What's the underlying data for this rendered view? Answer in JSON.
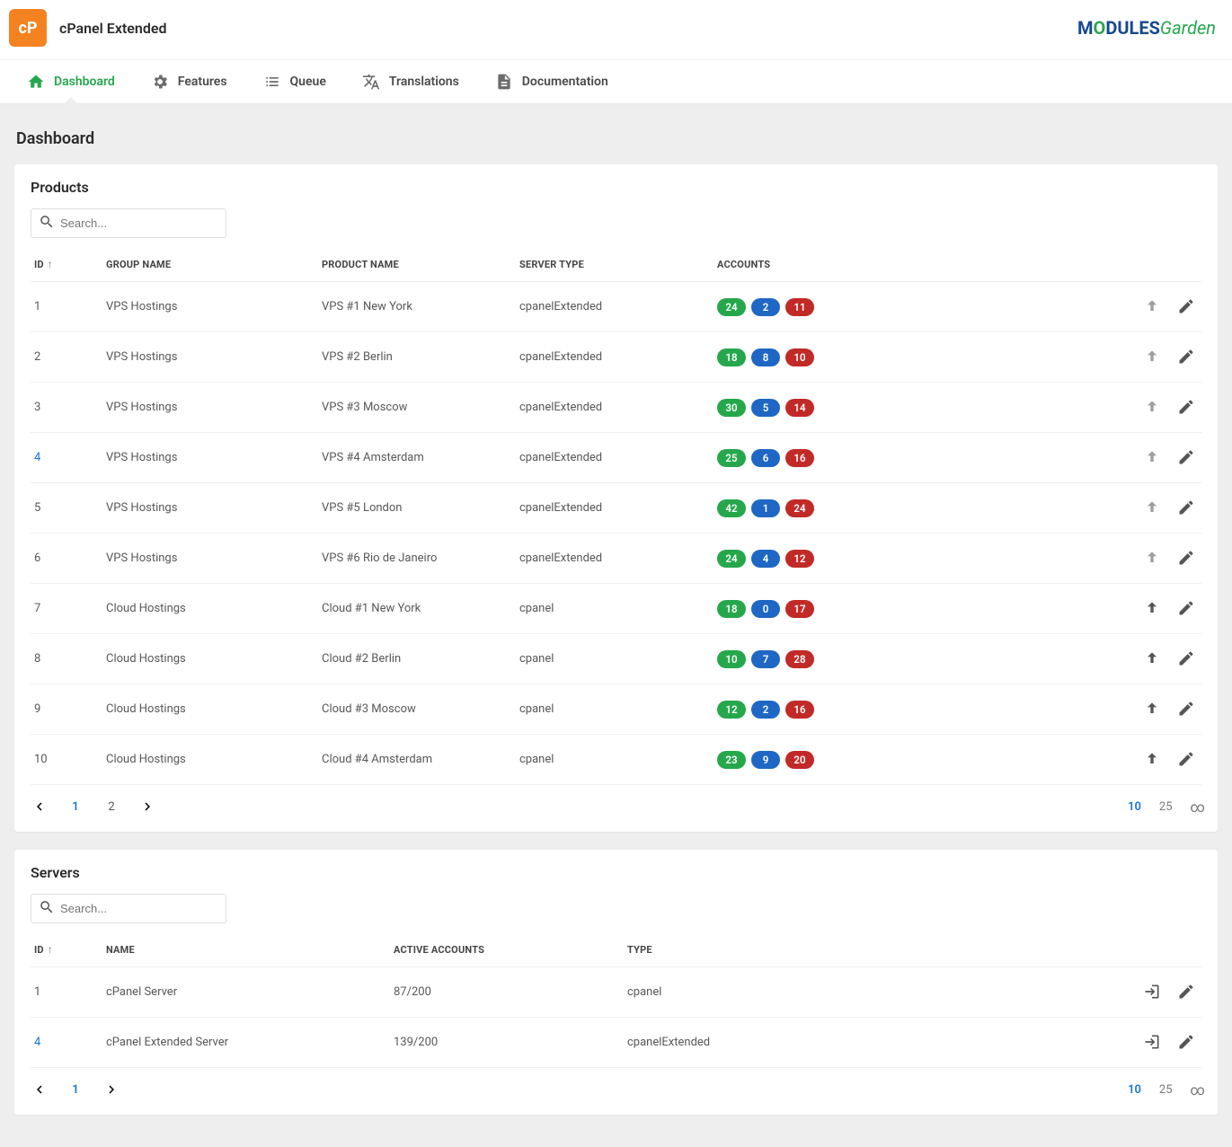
{
  "app": {
    "title": "cPanel Extended",
    "icon_label": "cP"
  },
  "nav": {
    "dashboard": "Dashboard",
    "features": "Features",
    "queue": "Queue",
    "translations": "Translations",
    "documentation": "Documentation"
  },
  "page_title": "Dashboard",
  "products": {
    "title": "Products",
    "search_placeholder": "Search...",
    "columns": {
      "id": "ID",
      "group": "GROUP NAME",
      "product": "PRODUCT NAME",
      "server": "SERVER TYPE",
      "accounts": "ACCOUNTS"
    },
    "rows": [
      {
        "id": "1",
        "group": "VPS Hostings",
        "product": "VPS #1 New York",
        "server": "cpanelExtended",
        "a": "24",
        "b": "2",
        "c": "11",
        "hl": false,
        "arrow_dark": false
      },
      {
        "id": "2",
        "group": "VPS Hostings",
        "product": "VPS #2 Berlin",
        "server": "cpanelExtended",
        "a": "18",
        "b": "8",
        "c": "10",
        "hl": false,
        "arrow_dark": false
      },
      {
        "id": "3",
        "group": "VPS Hostings",
        "product": "VPS #3 Moscow",
        "server": "cpanelExtended",
        "a": "30",
        "b": "5",
        "c": "14",
        "hl": false,
        "arrow_dark": false
      },
      {
        "id": "4",
        "group": "VPS Hostings",
        "product": "VPS #4 Amsterdam",
        "server": "cpanelExtended",
        "a": "25",
        "b": "6",
        "c": "16",
        "hl": true,
        "arrow_dark": false
      },
      {
        "id": "5",
        "group": "VPS Hostings",
        "product": "VPS #5 London",
        "server": "cpanelExtended",
        "a": "42",
        "b": "1",
        "c": "24",
        "hl": false,
        "arrow_dark": false
      },
      {
        "id": "6",
        "group": "VPS Hostings",
        "product": "VPS #6 Rio de Janeiro",
        "server": "cpanelExtended",
        "a": "24",
        "b": "4",
        "c": "12",
        "hl": false,
        "arrow_dark": false
      },
      {
        "id": "7",
        "group": "Cloud Hostings",
        "product": "Cloud #1 New York",
        "server": "cpanel",
        "a": "18",
        "b": "0",
        "c": "17",
        "hl": false,
        "arrow_dark": true
      },
      {
        "id": "8",
        "group": "Cloud Hostings",
        "product": "Cloud #2 Berlin",
        "server": "cpanel",
        "a": "10",
        "b": "7",
        "c": "28",
        "hl": false,
        "arrow_dark": true
      },
      {
        "id": "9",
        "group": "Cloud Hostings",
        "product": "Cloud #3 Moscow",
        "server": "cpanel",
        "a": "12",
        "b": "2",
        "c": "16",
        "hl": false,
        "arrow_dark": true
      },
      {
        "id": "10",
        "group": "Cloud Hostings",
        "product": "Cloud #4 Amsterdam",
        "server": "cpanel",
        "a": "23",
        "b": "9",
        "c": "20",
        "hl": false,
        "arrow_dark": true
      }
    ],
    "pagination": {
      "pages": [
        "1",
        "2"
      ],
      "current": "1",
      "sizes": [
        "10",
        "25",
        "∞"
      ],
      "current_size": "10"
    }
  },
  "servers": {
    "title": "Servers",
    "search_placeholder": "Search...",
    "columns": {
      "id": "ID",
      "name": "NAME",
      "active": "ACTIVE ACCOUNTS",
      "type": "TYPE"
    },
    "rows": [
      {
        "id": "1",
        "name": "cPanel Server",
        "active": "87/200",
        "type": "cpanel",
        "hl": false
      },
      {
        "id": "4",
        "name": "cPanel Extended Server",
        "active": "139/200",
        "type": "cpanelExtended",
        "hl": true
      }
    ],
    "pagination": {
      "pages": [
        "1"
      ],
      "current": "1",
      "sizes": [
        "10",
        "25",
        "∞"
      ],
      "current_size": "10"
    }
  }
}
